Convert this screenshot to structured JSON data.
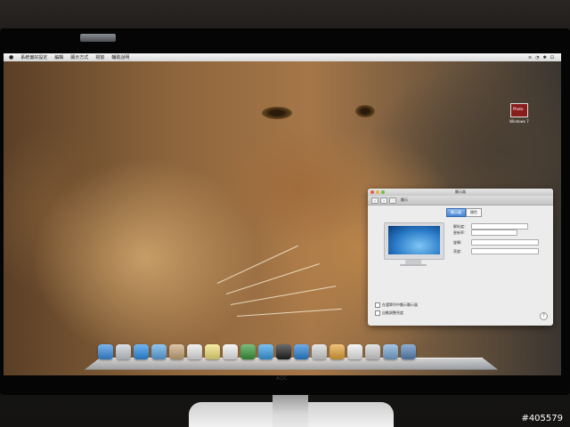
{
  "menubar": {
    "apple_icon": "apple-logo",
    "items": [
      "系統偏好設定",
      "編輯",
      "顯示方式",
      "視窗",
      "輔助說明"
    ],
    "status": [
      "≋",
      "◔",
      "✱",
      "⊡"
    ]
  },
  "desktop_icon": {
    "label": "Windows 7",
    "thumb_text": "Photo"
  },
  "prefs": {
    "window_title": "顯示器",
    "toolbar_label": "顯示",
    "tabs": [
      "顯示器",
      "顏色"
    ],
    "rows": [
      {
        "label": "解析度：",
        "value": ""
      },
      {
        "label": "更新率：",
        "value": ""
      },
      {
        "label": "旋轉：",
        "value": ""
      },
      {
        "label": "亮度：",
        "value": ""
      }
    ],
    "checkboxes": [
      "在選單列中顯示顯示器",
      "自動調整亮度"
    ],
    "help": "?"
  },
  "dock": {
    "icon_names": [
      "finder",
      "launchpad",
      "safari",
      "mail",
      "contacts",
      "calendar",
      "notes",
      "reminders",
      "facetime",
      "itunes",
      "photobooth",
      "appstore",
      "preview",
      "chrome",
      "documents",
      "trash",
      "folder",
      "downloads"
    ],
    "colors": [
      "#3a8ee0",
      "#c9cfd6",
      "#2e8fe8",
      "#5ea8e6",
      "#c9a87a",
      "#e9e9e9",
      "#f2e27a",
      "#f1f1f1",
      "#3c9a3c",
      "#3aa0e8",
      "#222222",
      "#2a83d8",
      "#d8d8d8",
      "#e5a53a",
      "#f0f0f0",
      "#d6d6d6",
      "#7aa8d6",
      "#5a86b8"
    ]
  },
  "monitor": {
    "brand": "AOC"
  },
  "watermark": "#405579"
}
